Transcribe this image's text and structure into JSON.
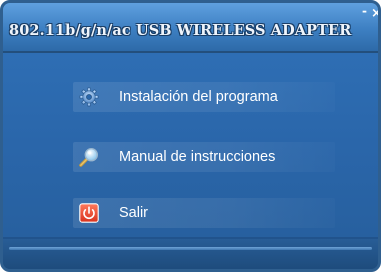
{
  "window": {
    "title": "802.11b/g/n/ac USB WIRELESS ADAPTER",
    "minimize_label": "-",
    "close_label": "×"
  },
  "menu": {
    "items": [
      {
        "label": "Instalación del programa",
        "icon": "gear-icon"
      },
      {
        "label": "Manual de instrucciones",
        "icon": "magnifier-icon"
      },
      {
        "label": "Salir",
        "icon": "power-icon"
      }
    ]
  },
  "colors": {
    "background": "#2a66aa",
    "titlebar": "#3d7fc2",
    "power_icon": "#e0402a"
  }
}
